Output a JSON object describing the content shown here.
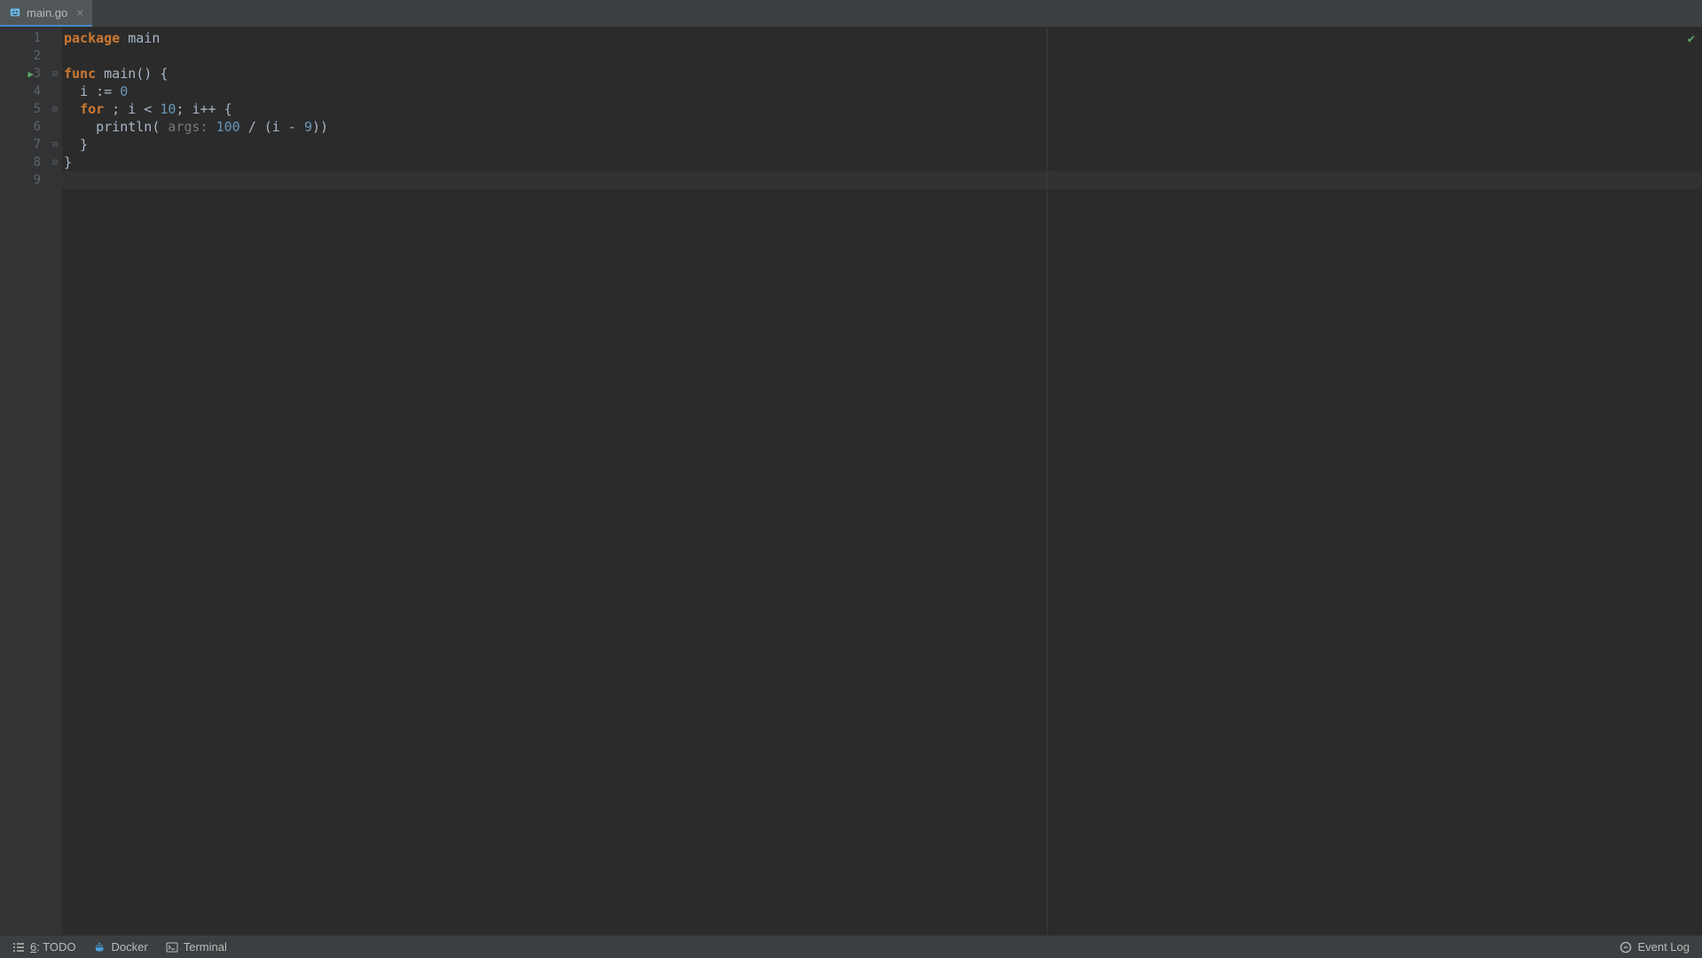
{
  "tab": {
    "filename": "main.go"
  },
  "code": {
    "lines": [
      {
        "n": "1"
      },
      {
        "n": "2"
      },
      {
        "n": "3"
      },
      {
        "n": "4"
      },
      {
        "n": "5"
      },
      {
        "n": "6"
      },
      {
        "n": "7"
      },
      {
        "n": "8"
      },
      {
        "n": "9"
      }
    ],
    "tokens": {
      "l1_package": "package",
      "l1_main": " main",
      "l3_func": "func",
      "l3_rest": " main() {",
      "l4": "  i := ",
      "l4_num": "0",
      "l5_indent": "  ",
      "l5_for": "for",
      "l5_a": " ; i < ",
      "l5_ten": "10",
      "l5_b": "; i++ {",
      "l6_a": "    println( ",
      "l6_hint": "args:",
      "l6_b": " ",
      "l6_hundred": "100",
      "l6_c": " / (i - ",
      "l6_nine": "9",
      "l6_d": "))",
      "l7": "  }",
      "l8": "}"
    }
  },
  "bottombar": {
    "todo_prefix": "6",
    "todo_label": ": TODO",
    "docker": "Docker",
    "terminal": "Terminal",
    "eventlog": "Event Log"
  }
}
